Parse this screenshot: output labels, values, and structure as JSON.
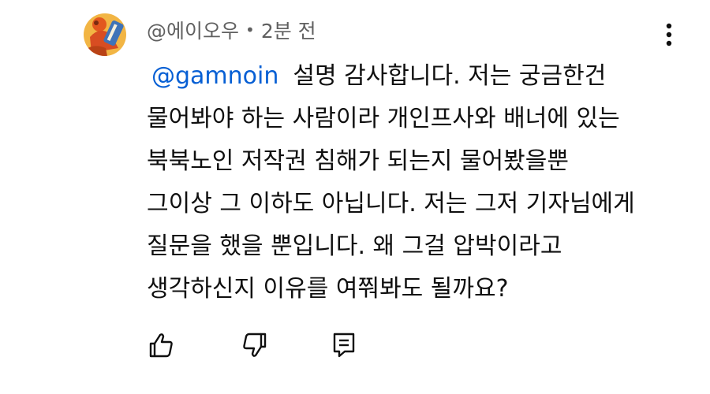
{
  "comment": {
    "author": "@에이오우",
    "separator": "•",
    "timestamp": "2분 전",
    "mention": "@gamnoin",
    "lines": [
      "설명 감사합니다. 저는 궁금한건",
      "물어봐야 하는 사람이라 개인프사와 배너에 있는",
      "북북노인 저작권 침해가 되는지 물어봤을뿐",
      "그이상 그 이하도 아닙니다. 저는 그저 기자님에게",
      "질문을 했을 뿐입니다. 왜 그걸 압박이라고",
      "생각하신지 이유를 여쭤봐도 될까요?"
    ]
  },
  "icons": {
    "menu": "more-vert-icon",
    "like": "thumbs-up-icon",
    "dislike": "thumbs-down-icon",
    "reply": "reply-icon"
  },
  "colors": {
    "mention": "#065fd4",
    "meta_text": "#606060",
    "body_text": "#0f0f0f"
  }
}
